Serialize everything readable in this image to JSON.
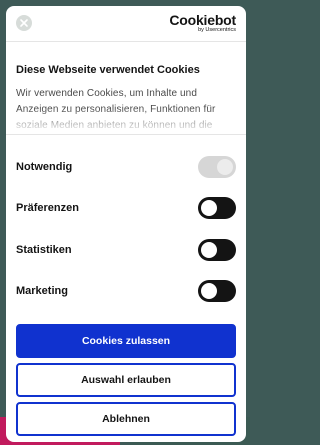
{
  "colors": {
    "accent": "#1032cf",
    "toggle_on": "#141414",
    "toggle_disabled": "#d6d6d6"
  },
  "header": {
    "logo_text": "Cookiebot",
    "logo_sub": "by Usercentrics",
    "close_icon": "close-icon"
  },
  "notice": {
    "title": "Diese Webseite verwendet Cookies",
    "description": "Wir verwenden Cookies, um Inhalte und Anzeigen zu personalisieren, Funktionen für soziale Medien anbieten zu können und die"
  },
  "toggles": [
    {
      "label": "Notwendig",
      "state": "disabled-on"
    },
    {
      "label": "Präferenzen",
      "state": "off"
    },
    {
      "label": "Statistiken",
      "state": "off"
    },
    {
      "label": "Marketing",
      "state": "off"
    }
  ],
  "buttons": {
    "allow_all": "Cookies zulassen",
    "allow_selection": "Auswahl erlauben",
    "deny": "Ablehnen"
  }
}
